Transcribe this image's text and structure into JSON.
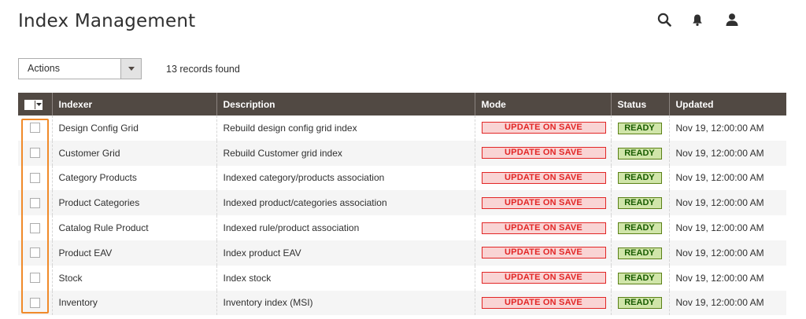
{
  "page": {
    "title": "Index Management"
  },
  "header": {
    "icons": [
      "search-icon",
      "notifications-icon",
      "account-icon"
    ]
  },
  "toolbar": {
    "actions_label": "Actions",
    "records_found": "13 records found"
  },
  "grid": {
    "columns": [
      "Indexer",
      "Description",
      "Mode",
      "Status",
      "Updated"
    ],
    "rows": [
      {
        "indexer": "Design Config Grid",
        "description": "Rebuild design config grid index",
        "mode": "UPDATE ON SAVE",
        "status": "READY",
        "updated": "Nov 19, 12:00:00 AM"
      },
      {
        "indexer": "Customer Grid",
        "description": "Rebuild Customer grid index",
        "mode": "UPDATE ON SAVE",
        "status": "READY",
        "updated": "Nov 19, 12:00:00 AM"
      },
      {
        "indexer": "Category Products",
        "description": "Indexed category/products association",
        "mode": "UPDATE ON SAVE",
        "status": "READY",
        "updated": "Nov 19, 12:00:00 AM"
      },
      {
        "indexer": "Product Categories",
        "description": "Indexed product/categories association",
        "mode": "UPDATE ON SAVE",
        "status": "READY",
        "updated": "Nov 19, 12:00:00 AM"
      },
      {
        "indexer": "Catalog Rule Product",
        "description": "Indexed rule/product association",
        "mode": "UPDATE ON SAVE",
        "status": "READY",
        "updated": "Nov 19, 12:00:00 AM"
      },
      {
        "indexer": "Product EAV",
        "description": "Index product EAV",
        "mode": "UPDATE ON SAVE",
        "status": "READY",
        "updated": "Nov 19, 12:00:00 AM"
      },
      {
        "indexer": "Stock",
        "description": "Index stock",
        "mode": "UPDATE ON SAVE",
        "status": "READY",
        "updated": "Nov 19, 12:00:00 AM"
      },
      {
        "indexer": "Inventory",
        "description": "Inventory index (MSI)",
        "mode": "UPDATE ON SAVE",
        "status": "READY",
        "updated": "Nov 19, 12:00:00 AM"
      }
    ]
  },
  "colors": {
    "header_bg": "#514943",
    "mode_text": "#e22626",
    "mode_bg": "#f9d4d4",
    "status_text": "#185b00",
    "status_bg": "#d0e5a9",
    "highlight": "#f08a2a"
  }
}
